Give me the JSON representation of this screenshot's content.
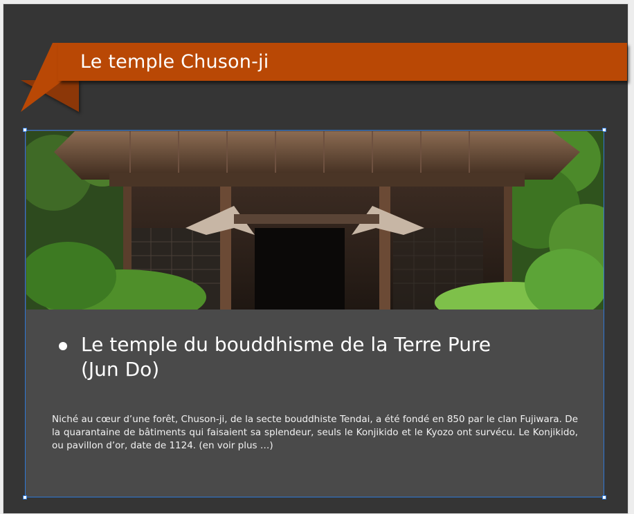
{
  "slide": {
    "title": "Le temple Chuson-ji",
    "bullet_heading": "Le temple du bouddhisme de la Terre Pure (Jun Do)",
    "body": "Niché au cœur d’une forêt, Chuson-ji, de la secte bouddhiste Tendai,  a été fondé en 850 par le clan Fujiwara. De la  quarantaine de bâtiments qui faisaient sa splendeur, seuls le Konjikido et le Kyozo ont survécu. Le Konjikido, ou pavillon d’or, date de 1124. (en voir plus …)"
  },
  "colors": {
    "ribbon": "#b94805",
    "ribbon_fold": "#8c3708",
    "background": "#353535",
    "panel": "#4a4a4a",
    "selection": "#2f78d6"
  },
  "icons": {
    "bullet": "bullet-dot-icon"
  }
}
